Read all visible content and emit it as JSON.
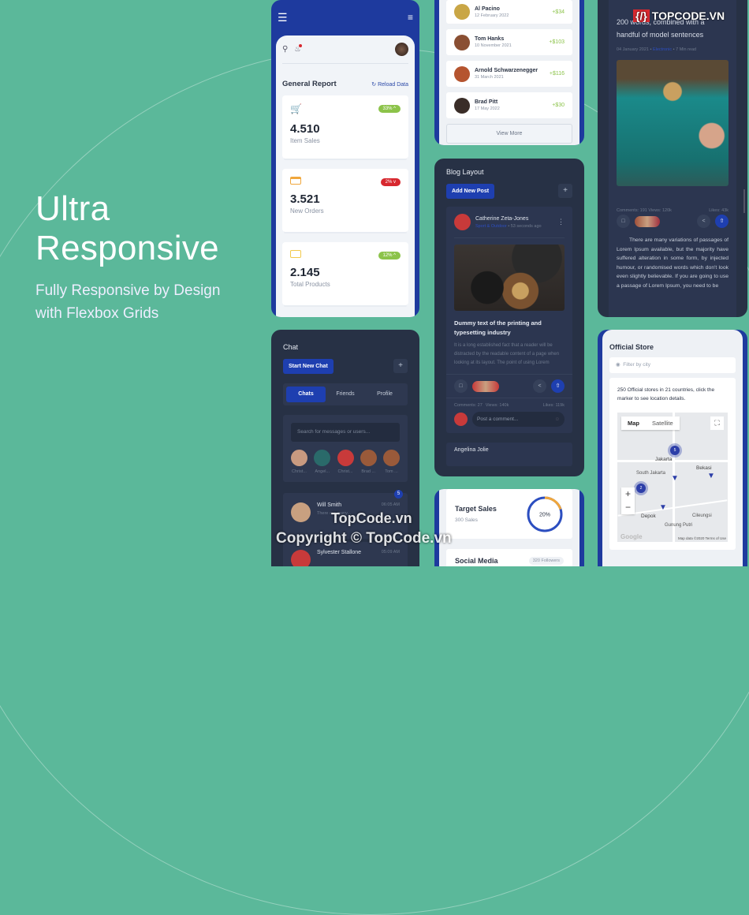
{
  "hero": {
    "title_line1": "Ultra",
    "title_line2": "Responsive",
    "subtitle_line1": "Fully Responsive by Design",
    "subtitle_line2": "with Flexbox Grids"
  },
  "colors": {
    "background": "#5bb89a",
    "primary": "#1e3a9e",
    "dark": "#273145",
    "success": "#8cc34a",
    "danger": "#d7282f"
  },
  "report": {
    "title": "General Report",
    "reload_label": "Reload Data",
    "stats": [
      {
        "icon": "cart-icon",
        "value": "4.510",
        "label": "Item Sales",
        "badge": "33% ^",
        "trend": "up"
      },
      {
        "icon": "credit-card-icon",
        "value": "3.521",
        "label": "New Orders",
        "badge": "2% v",
        "trend": "down"
      },
      {
        "icon": "monitor-icon",
        "value": "2.145",
        "label": "Total Products",
        "badge": "12% ^",
        "trend": "up"
      }
    ]
  },
  "transactions": {
    "items": [
      {
        "name": "Al Pacino",
        "date": "12 February 2022",
        "amount": "+$34"
      },
      {
        "name": "Tom Hanks",
        "date": "10 November 2021",
        "amount": "+$103"
      },
      {
        "name": "Arnold Schwarzenegger",
        "date": "31 March 2021",
        "amount": "+$116"
      },
      {
        "name": "Brad Pitt",
        "date": "17 May 2022",
        "amount": "+$30"
      }
    ],
    "view_more": "View More"
  },
  "blog": {
    "title": "Blog Layout",
    "add_label": "Add New Post",
    "plus": "+",
    "post": {
      "author": "Catherine Zeta-Jones",
      "category": "Sport & Outdoor",
      "time": "• 53 seconds ago",
      "headline": "Dummy text of the printing and typesetting industry",
      "body": "It is a long established fact that a reader will be distracted by the readable content of a page when looking at its layout. The point of using Lorem",
      "comments": "Comments: 27",
      "views": "Views: 140k",
      "likes": "Likes: 119k",
      "comment_placeholder": "Post a comment..."
    },
    "next_author": "Angelina Jolie"
  },
  "article": {
    "headline": "200 words, combined with a handful of model sentences",
    "date": "04 January 2021",
    "category": "Electronic",
    "read_time": "7 Min read",
    "comments": "Comments: 191",
    "views": "Views: 120k",
    "likes": "Likes: 43k",
    "body": "There are many variations of passages of Lorem Ipsum available, but the majority have suffered alteration in some form, by injected humour, or randomised words which don't look even slightly believable. If you are going to use a passage of Lorem Ipsum, you need to be"
  },
  "chat": {
    "title": "Chat",
    "start_label": "Start New Chat",
    "plus": "+",
    "tabs": [
      "Chats",
      "Friends",
      "Profile"
    ],
    "search_placeholder": "Search for messages or users...",
    "contacts": [
      "Christ...",
      "Angel...",
      "Christ...",
      "Brad ...",
      "Tom ..."
    ],
    "conversations": [
      {
        "name": "Will Smith",
        "preview": "There are many...",
        "time": "06:05 AM",
        "unread": "5"
      },
      {
        "name": "Sylvester Stallone",
        "preview": "",
        "time": "05:09 AM"
      }
    ]
  },
  "target": {
    "title": "Target Sales",
    "sub": "300 Sales",
    "percent_label": "20%",
    "progress": 0.2
  },
  "social": {
    "title": "Social Media",
    "followers": "320 Followers"
  },
  "store": {
    "title": "Official Store",
    "filter_placeholder": "Filter by city",
    "description": "250 Official stores in 21 countries, click the marker to see location details.",
    "map_tabs": [
      "Map",
      "Satellite"
    ],
    "places": [
      "Jakarta",
      "South Jakarta",
      "Bekasi",
      "Depok",
      "Cileungsi",
      "Gunung Putri"
    ],
    "clusters": [
      "5",
      "2"
    ],
    "zoom_in": "+",
    "zoom_out": "−",
    "attribution": "Map data ©2020 Terms of Use",
    "logo": "Google"
  },
  "watermark": {
    "brand": "TOPCODE.VN",
    "line1": "TopCode.vn",
    "line2": "Copyright © TopCode.vn"
  }
}
